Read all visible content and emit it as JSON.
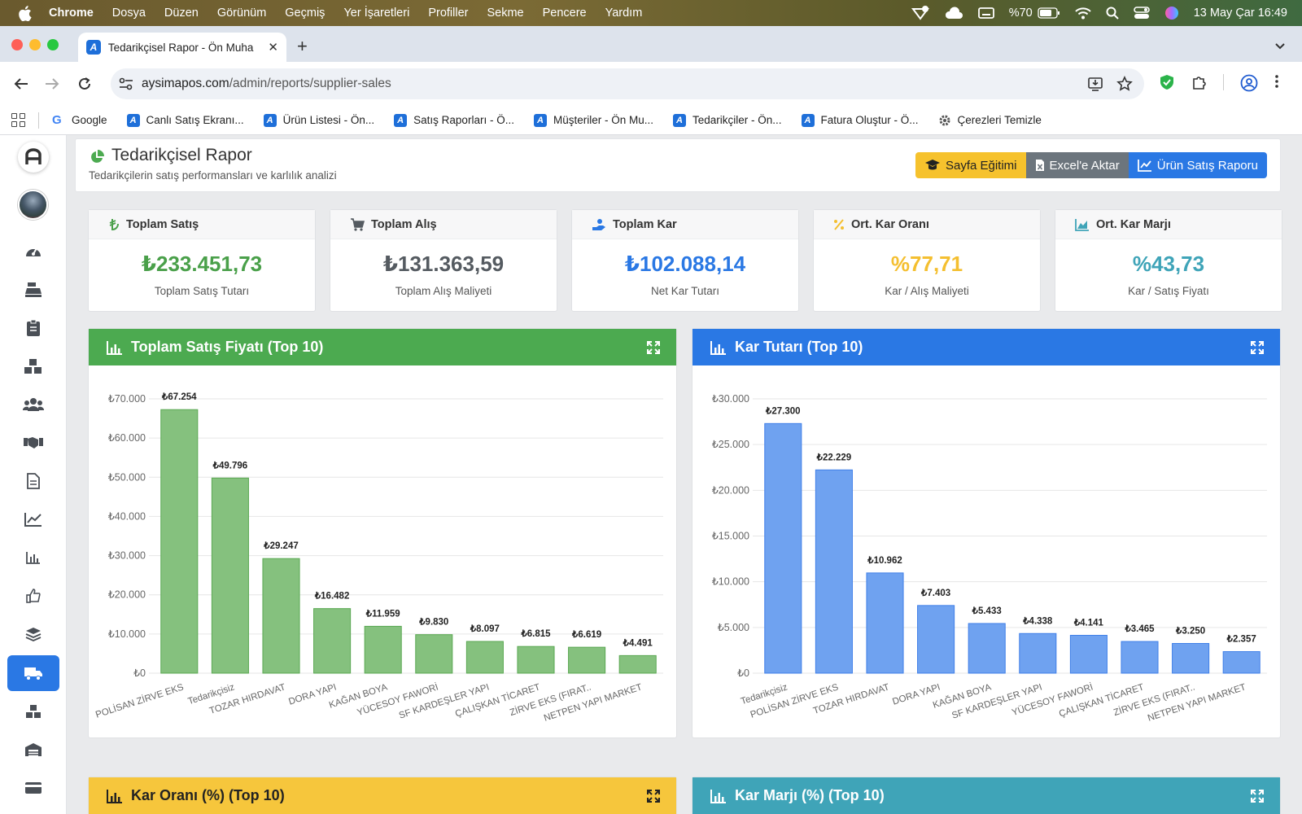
{
  "menubar": {
    "app": "Chrome",
    "items": [
      "Dosya",
      "Düzen",
      "Görünüm",
      "Geçmiş",
      "Yer İşaretleri",
      "Profiller",
      "Sekme",
      "Pencere",
      "Yardım"
    ],
    "battery": "%70",
    "datetime": "13 May Çar  16:49"
  },
  "browser": {
    "tab_title": "Tedarikçisel Rapor - Ön Muha",
    "url_host": "aysimapos.com",
    "url_path": "/admin/reports/supplier-sales",
    "bookmarks": [
      "Google",
      "Canlı Satış Ekranı...",
      "Ürün Listesi - Ön...",
      "Satış Raporları - Ö...",
      "Müşteriler - Ön Mu...",
      "Tedarikçiler - Ön...",
      "Fatura Oluştur - Ö...",
      "Çerezleri Temizle"
    ]
  },
  "page": {
    "title": "Tedarikçisel Rapor",
    "subtitle": "Tedarikçilerin satış performansları ve karlılık analizi",
    "buttons": {
      "training": "Sayfa Eğitimi",
      "excel": "Excel'e Aktar",
      "product_report": "Ürün Satış Raporu"
    }
  },
  "stats": [
    {
      "title": "Toplam Satış",
      "value": "₺233.451,73",
      "label": "Toplam Satış Tutarı",
      "color": "#4aa04a",
      "icon": "lira-icon"
    },
    {
      "title": "Toplam Alış",
      "value": "₺131.363,59",
      "label": "Toplam Alış Maliyeti",
      "color": "#555b61",
      "icon": "cart-icon"
    },
    {
      "title": "Toplam Kar",
      "value": "₺102.088,14",
      "label": "Net Kar Tutarı",
      "color": "#2a78e4",
      "icon": "hand-coin-icon"
    },
    {
      "title": "Ort. Kar Oranı",
      "value": "%77,71",
      "label": "Kar / Alış Maliyeti",
      "color": "#f4bf30",
      "icon": "percent-icon"
    },
    {
      "title": "Ort. Kar Marjı",
      "value": "%43,73",
      "label": "Kar / Satış Fiyatı",
      "color": "#3fa4b8",
      "icon": "area-chart-icon"
    }
  ],
  "chart_panels": [
    {
      "title": "Toplam Satış Fiyatı (Top 10)",
      "color": "#4caa50"
    },
    {
      "title": "Kar Tutarı (Top 10)",
      "color": "#2a78e4"
    },
    {
      "title": "Kar Oranı (%) (Top 10)",
      "color": "#f6c63c"
    },
    {
      "title": "Kar Marjı (%) (Top 10)",
      "color": "#3fa4b8"
    }
  ],
  "chart_data": [
    {
      "type": "bar",
      "title": "Toplam Satış Fiyatı (Top 10)",
      "categories": [
        "POLİSAN ZİRVE EKS",
        "Tedarikçisiz",
        "TOZAR HIRDAVAT",
        "DORA YAPI",
        "KAĞAN BOYA",
        "YÜCESOY FAWORİ",
        "SF KARDEŞLER YAPI",
        "ÇALIŞKAN TİCARET",
        "ZİRVE EKS (FIRAT..",
        "NETPEN YAPI MARKET"
      ],
      "values": [
        67254,
        49796,
        29247,
        16482,
        11959,
        9830,
        8097,
        6815,
        6619,
        4491
      ],
      "value_labels": [
        "₺67.254",
        "₺49.796",
        "₺29.247",
        "₺16.482",
        "₺11.959",
        "₺9.830",
        "₺8.097",
        "₺6.815",
        "₺6.619",
        "₺4.491"
      ],
      "yticks": [
        "₺0",
        "₺10.000",
        "₺20.000",
        "₺30.000",
        "₺40.000",
        "₺50.000",
        "₺60.000",
        "₺70.000"
      ],
      "ylim": [
        0,
        70000
      ],
      "bar_color": "#85c17e",
      "bar_border": "#5aa852",
      "grid": true
    },
    {
      "type": "bar",
      "title": "Kar Tutarı (Top 10)",
      "categories": [
        "Tedarikçisiz",
        "POLİSAN ZİRVE EKS",
        "TOZAR HIRDAVAT",
        "DORA YAPI",
        "KAĞAN BOYA",
        "SF KARDEŞLER YAPI",
        "YÜCESOY FAWORİ",
        "ÇALIŞKAN TİCARET",
        "ZİRVE EKS (FIRAT..",
        "NETPEN YAPI MARKET"
      ],
      "values": [
        27300,
        22229,
        10962,
        7403,
        5433,
        4338,
        4141,
        3465,
        3250,
        2357
      ],
      "value_labels": [
        "₺27.300",
        "₺22.229",
        "₺10.962",
        "₺7.403",
        "₺5.433",
        "₺4.338",
        "₺4.141",
        "₺3.465",
        "₺3.250",
        "₺2.357"
      ],
      "yticks": [
        "₺0",
        "₺5.000",
        "₺10.000",
        "₺15.000",
        "₺20.000",
        "₺25.000",
        "₺30.000"
      ],
      "ylim": [
        0,
        30000
      ],
      "bar_color": "#6fa2f0",
      "bar_border": "#3f7fe8",
      "grid": true
    }
  ]
}
